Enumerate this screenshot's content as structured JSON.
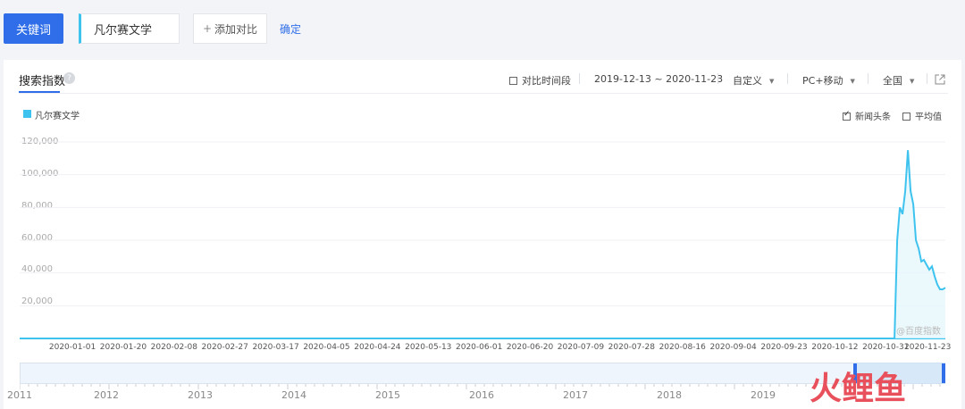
{
  "toolbar": {
    "keyword_button": "关键词",
    "keyword_value": "凡尔赛文学",
    "add_compare": "添加对比",
    "add_icon": "+",
    "confirm": "确定"
  },
  "panel": {
    "tab": "搜索指数",
    "help_icon": "?",
    "compare_period": "对比时间段",
    "date_range": "2019-12-13 ~ 2020-11-23",
    "custom": "自定义",
    "device": "PC+移动",
    "region": "全国",
    "export_icon": "external-link-icon",
    "news_headlines": "新闻头条",
    "average": "平均值",
    "watermark": "@百度指数"
  },
  "colors": {
    "accent": "#2f6ee8",
    "series": "#3ec3ef"
  },
  "chart_data": {
    "type": "area",
    "series": [
      {
        "name": "凡尔赛文学",
        "values": [
          {
            "x": "2019-12-13",
            "y": 0
          },
          {
            "x": "2020-11-01",
            "y": 0
          },
          {
            "x": "2020-11-04",
            "y": 0
          },
          {
            "x": "2020-11-05",
            "y": 60000
          },
          {
            "x": "2020-11-06",
            "y": 80000
          },
          {
            "x": "2020-11-07",
            "y": 76000
          },
          {
            "x": "2020-11-08",
            "y": 90000
          },
          {
            "x": "2020-11-09",
            "y": 115000
          },
          {
            "x": "2020-11-10",
            "y": 90000
          },
          {
            "x": "2020-11-11",
            "y": 82000
          },
          {
            "x": "2020-11-12",
            "y": 60000
          },
          {
            "x": "2020-11-13",
            "y": 55000
          },
          {
            "x": "2020-11-14",
            "y": 47000
          },
          {
            "x": "2020-11-15",
            "y": 48000
          },
          {
            "x": "2020-11-16",
            "y": 45000
          },
          {
            "x": "2020-11-17",
            "y": 42000
          },
          {
            "x": "2020-11-18",
            "y": 44000
          },
          {
            "x": "2020-11-19",
            "y": 38000
          },
          {
            "x": "2020-11-20",
            "y": 33000
          },
          {
            "x": "2020-11-21",
            "y": 30000
          },
          {
            "x": "2020-11-22",
            "y": 30000
          },
          {
            "x": "2020-11-23",
            "y": 31000
          }
        ]
      }
    ],
    "ylim": [
      0,
      120000
    ],
    "yticks": [
      "120,000",
      "100,000",
      "80,000",
      "60,000",
      "40,000",
      "20,000"
    ],
    "xticks": [
      "2020-01-01",
      "2020-01-20",
      "2020-02-08",
      "2020-02-27",
      "2020-03-17",
      "2020-04-05",
      "2020-04-24",
      "2020-05-13",
      "2020-06-01",
      "2020-06-20",
      "2020-07-09",
      "2020-07-28",
      "2020-08-16",
      "2020-09-04",
      "2020-09-23",
      "2020-10-12",
      "2020-10-31",
      "2020-11-23"
    ],
    "grid": true,
    "legend": "top-left"
  },
  "timeline": {
    "years": [
      "2011",
      "2012",
      "2013",
      "2014",
      "2015",
      "2016",
      "2017",
      "2018",
      "2019"
    ]
  },
  "logo": {
    "text": "火鲤鱼"
  }
}
